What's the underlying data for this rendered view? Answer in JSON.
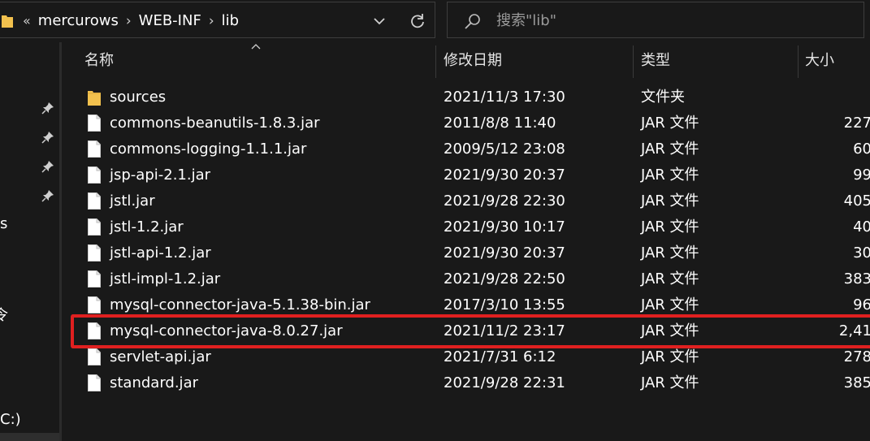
{
  "address_bar": {
    "overflow_chevron": "«",
    "breadcrumbs": [
      "mercurows",
      "WEB-INF",
      "lib"
    ],
    "dropdown_icon": "chevron-down-icon",
    "refresh_icon": "refresh-icon"
  },
  "search": {
    "placeholder": "搜索\"lib\""
  },
  "nav": {
    "fragments": [
      "s",
      "令",
      "C:)"
    ]
  },
  "columns": {
    "name": "名称",
    "date": "修改日期",
    "type": "类型",
    "size": "大小"
  },
  "files": [
    {
      "name": "sources",
      "date": "2021/11/3 17:30",
      "type": "文件夹",
      "size": "",
      "icon": "folder-icon"
    },
    {
      "name": "commons-beanutils-1.8.3.jar",
      "date": "2011/8/8 11:40",
      "type": "JAR 文件",
      "size": "227",
      "icon": "file-icon"
    },
    {
      "name": "commons-logging-1.1.1.jar",
      "date": "2009/5/12 23:08",
      "type": "JAR 文件",
      "size": "60",
      "icon": "file-icon"
    },
    {
      "name": "jsp-api-2.1.jar",
      "date": "2021/9/30 20:37",
      "type": "JAR 文件",
      "size": "99",
      "icon": "file-icon"
    },
    {
      "name": "jstl.jar",
      "date": "2021/9/28 22:30",
      "type": "JAR 文件",
      "size": "405",
      "icon": "file-icon"
    },
    {
      "name": "jstl-1.2.jar",
      "date": "2021/9/30 10:17",
      "type": "JAR 文件",
      "size": "40",
      "icon": "file-icon"
    },
    {
      "name": "jstl-api-1.2.jar",
      "date": "2021/9/30 20:37",
      "type": "JAR 文件",
      "size": "30",
      "icon": "file-icon"
    },
    {
      "name": "jstl-impl-1.2.jar",
      "date": "2021/9/28 22:50",
      "type": "JAR 文件",
      "size": "383",
      "icon": "file-icon"
    },
    {
      "name": "mysql-connector-java-5.1.38-bin.jar",
      "date": "2017/3/10 13:55",
      "type": "JAR 文件",
      "size": "96",
      "icon": "file-icon"
    },
    {
      "name": "mysql-connector-java-8.0.27.jar",
      "date": "2021/11/2 23:17",
      "type": "JAR 文件",
      "size": "2,41",
      "icon": "file-icon"
    },
    {
      "name": "servlet-api.jar",
      "date": "2021/7/31 6:12",
      "type": "JAR 文件",
      "size": "278",
      "icon": "file-icon"
    },
    {
      "name": "standard.jar",
      "date": "2021/9/28 22:31",
      "type": "JAR 文件",
      "size": "385",
      "icon": "file-icon"
    }
  ],
  "colors": {
    "background": "#191919",
    "highlight_border": "#e02020",
    "folder": "#f2c14e"
  }
}
